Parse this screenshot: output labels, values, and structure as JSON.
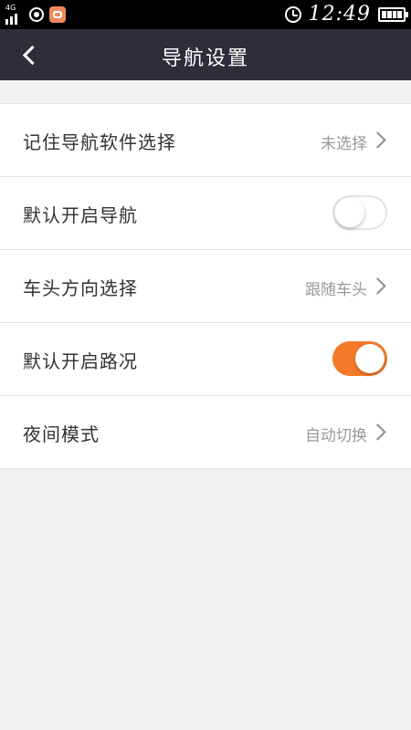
{
  "status_bar": {
    "network_label": "4G",
    "time": "12:49",
    "icons": [
      "signal-icon",
      "location-icon",
      "app-notification-icon",
      "alarm-icon",
      "battery-icon"
    ]
  },
  "header": {
    "title": "导航设置",
    "back_icon": "chevron-left-icon",
    "background": "#2d2e3a"
  },
  "settings": {
    "items": [
      {
        "label": "记住导航软件选择",
        "type": "select",
        "value": "未选择"
      },
      {
        "label": "默认开启导航",
        "type": "toggle",
        "on": false
      },
      {
        "label": "车头方向选择",
        "type": "select",
        "value": "跟随车头"
      },
      {
        "label": "默认开启路况",
        "type": "toggle",
        "on": true
      },
      {
        "label": "夜间模式",
        "type": "select",
        "value": "自动切换"
      }
    ]
  },
  "colors": {
    "accent": "#f57a2a",
    "page_background": "#f2f2f4",
    "text_primary": "#333333",
    "text_secondary": "#9a9a9a"
  }
}
